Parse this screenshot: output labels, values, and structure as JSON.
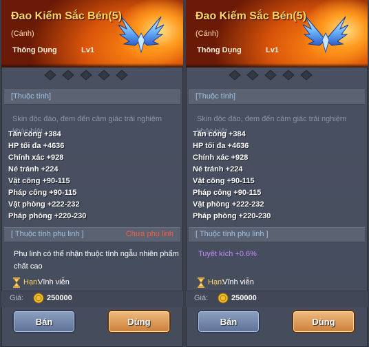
{
  "panels": [
    {
      "item_name": "Đao Kiếm Sắc Bén(5)",
      "item_sub": "(Cánh)",
      "item_type": "Thông Dụng",
      "item_level": "Lv1",
      "attr_title": "[Thuộc tính]",
      "description": "Skin độc đáo, đem đến cảm giác trải nghiệm khác biệt",
      "stats": [
        "Tấn công +384",
        "HP tối đa +4636",
        "Chính xác +928",
        "Né tránh +224",
        "Vật công +90-115",
        "Pháp công +90-115",
        "Vật phòng +222-232",
        "Pháp phòng +220-230"
      ],
      "spirit_title": "[ Thuộc tính phụ linh ]",
      "spirit_status": "Chưa phụ linh",
      "spirit_text": "Phụ linh có thể nhận thuộc tính ngẫu nhiên phẩm chất cao",
      "limit_label": "Hạn:",
      "limit_value": "Vĩnh viễn",
      "price_label": "Giá:",
      "price_value": "250000",
      "sell_label": "Bán",
      "use_label": "Dùng"
    },
    {
      "item_name": "Đao Kiếm Sắc Bén(5)",
      "item_sub": "(Cánh)",
      "item_type": "Thông Dụng",
      "item_level": "Lv1",
      "attr_title": "[Thuộc tính]",
      "description": "Skin độc đáo, đem đến cảm giác trải nghiệm khác biệt",
      "stats": [
        "Tấn công +384",
        "HP tối đa +4636",
        "Chính xác +928",
        "Né tránh +224",
        "Vật công +90-115",
        "Pháp công +90-115",
        "Vật phòng +222-232",
        "Pháp phòng +220-230"
      ],
      "spirit_title": "[ Thuộc tính phụ linh ]",
      "spirit_stat": "Tuyệt kích +0.6%",
      "limit_label": "Hạn:",
      "limit_value": "Vĩnh viễn",
      "price_label": "Giá:",
      "price_value": "250000",
      "sell_label": "Bán",
      "use_label": "Dùng"
    }
  ],
  "colors": {
    "name_gold": "#ffd666",
    "status_red": "#ff5a3a",
    "spirit_purple": "#c38cff",
    "section_blue": "#9fc3e8"
  },
  "icons": {
    "wing": "blue-wing-icon",
    "star": "empty-star-icon",
    "hourglass": "hourglass-icon",
    "coin": "gold-coin-icon"
  }
}
